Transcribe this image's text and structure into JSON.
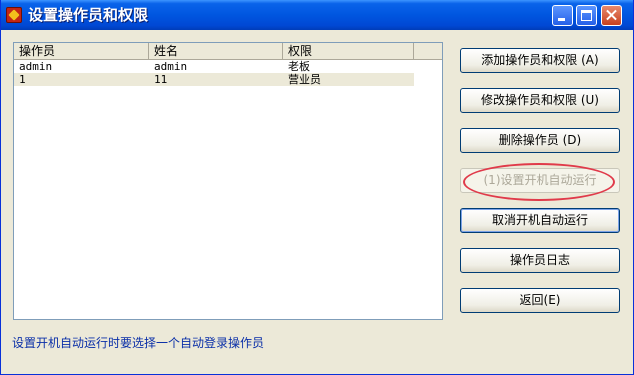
{
  "window": {
    "title": "设置操作员和权限"
  },
  "list": {
    "columns": [
      "操作员",
      "姓名",
      "权限"
    ],
    "rows": [
      [
        "admin",
        "admin",
        "老板"
      ],
      [
        "1",
        "11",
        "营业员"
      ]
    ]
  },
  "buttons": {
    "add": "添加操作员和权限 (A)",
    "modify": "修改操作员和权限 (U)",
    "delete": "删除操作员 (D)",
    "set_autorun": "(1)设置开机自动运行",
    "cancel_autorun": "取消开机自动运行",
    "log": "操作员日志",
    "back": "返回(E)"
  },
  "status_text": "设置开机自动运行时要选择一个自动登录操作员",
  "annotation": {
    "color": "#e03a4a"
  }
}
